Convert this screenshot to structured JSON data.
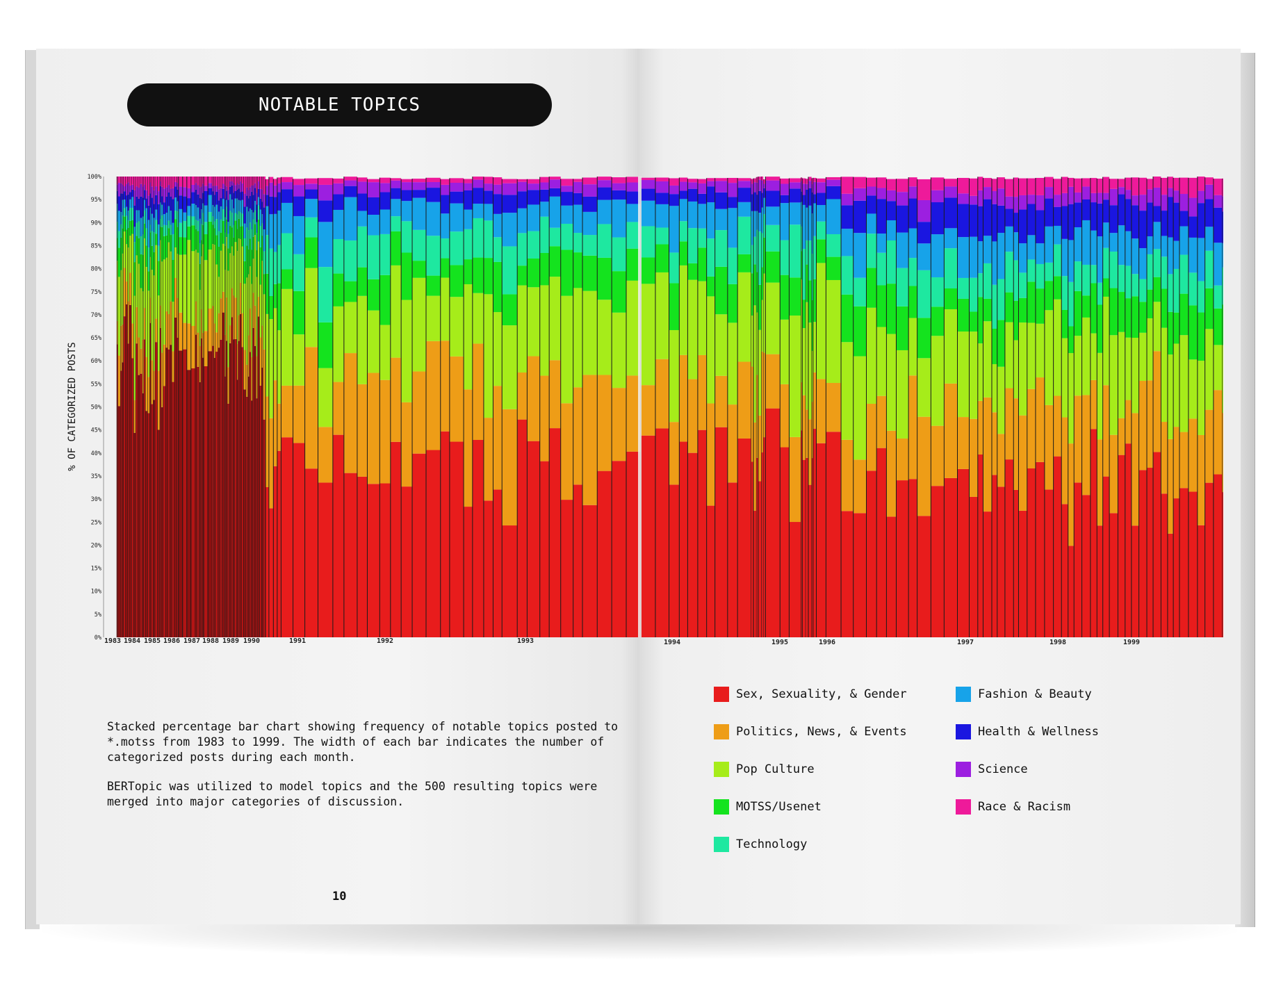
{
  "title": "NOTABLE TOPICS",
  "description": [
    "Stacked percentage bar chart showing frequency of notable topics posted to *.motss from 1983 to 1999. The width of each bar indicates the number of categorized posts during each month.",
    "BERTopic was utilized to model topics and the 500 resulting topics were merged into major categories of discussion."
  ],
  "page_number": "10",
  "chart_data": {
    "type": "bar",
    "stacked": true,
    "normalized": true,
    "ylabel": "% OF CATEGORIZED POSTS",
    "ylim": [
      0,
      100
    ],
    "yticks": [
      "0%",
      "5%",
      "10%",
      "15%",
      "20%",
      "25%",
      "30%",
      "35%",
      "40%",
      "45%",
      "50%",
      "55%",
      "60%",
      "65%",
      "70%",
      "75%",
      "80%",
      "85%",
      "90%",
      "95%",
      "100%"
    ],
    "xtick_labels": [
      "1983",
      "1984",
      "1985",
      "1986",
      "1987",
      "1988",
      "1989",
      "1990",
      "1991",
      "1992",
      "1993",
      "1994",
      "1995",
      "1996",
      "1997",
      "1998",
      "1999"
    ],
    "legend": [
      {
        "name": "Sex, Sexuality, & Gender",
        "color": "#e81c1c"
      },
      {
        "name": "Politics, News, & Events",
        "color": "#ee9d17"
      },
      {
        "name": "Pop Culture",
        "color": "#a6ec1a"
      },
      {
        "name": "MOTSS/Usenet",
        "color": "#14e31e"
      },
      {
        "name": "Technology",
        "color": "#1ee8a0"
      },
      {
        "name": "Fashion & Beauty",
        "color": "#17a3e9"
      },
      {
        "name": "Health & Wellness",
        "color": "#1a16e0"
      },
      {
        "name": "Science",
        "color": "#9c1fe0"
      },
      {
        "name": "Race & Racism",
        "color": "#ee1a9a"
      }
    ],
    "series": [
      {
        "name": "Sex, Sexuality, & Gender",
        "color": "#e81c1c",
        "approx_range_percent": [
          18,
          62
        ]
      },
      {
        "name": "Politics, News, & Events",
        "color": "#ee9d17",
        "approx_range_percent": [
          5,
          26
        ]
      },
      {
        "name": "Pop Culture",
        "color": "#a6ec1a",
        "approx_range_percent": [
          10,
          28
        ]
      },
      {
        "name": "MOTSS/Usenet",
        "color": "#14e31e",
        "approx_range_percent": [
          3,
          12
        ]
      },
      {
        "name": "Technology",
        "color": "#1ee8a0",
        "approx_range_percent": [
          3,
          12
        ]
      },
      {
        "name": "Fashion & Beauty",
        "color": "#17a3e9",
        "approx_range_percent": [
          3,
          10
        ]
      },
      {
        "name": "Health & Wellness",
        "color": "#1a16e0",
        "approx_range_percent": [
          1,
          8
        ]
      },
      {
        "name": "Science",
        "color": "#9c1fe0",
        "approx_range_percent": [
          0,
          6
        ]
      },
      {
        "name": "Race & Racism",
        "color": "#ee1a9a",
        "approx_range_percent": [
          0,
          5
        ]
      }
    ]
  }
}
